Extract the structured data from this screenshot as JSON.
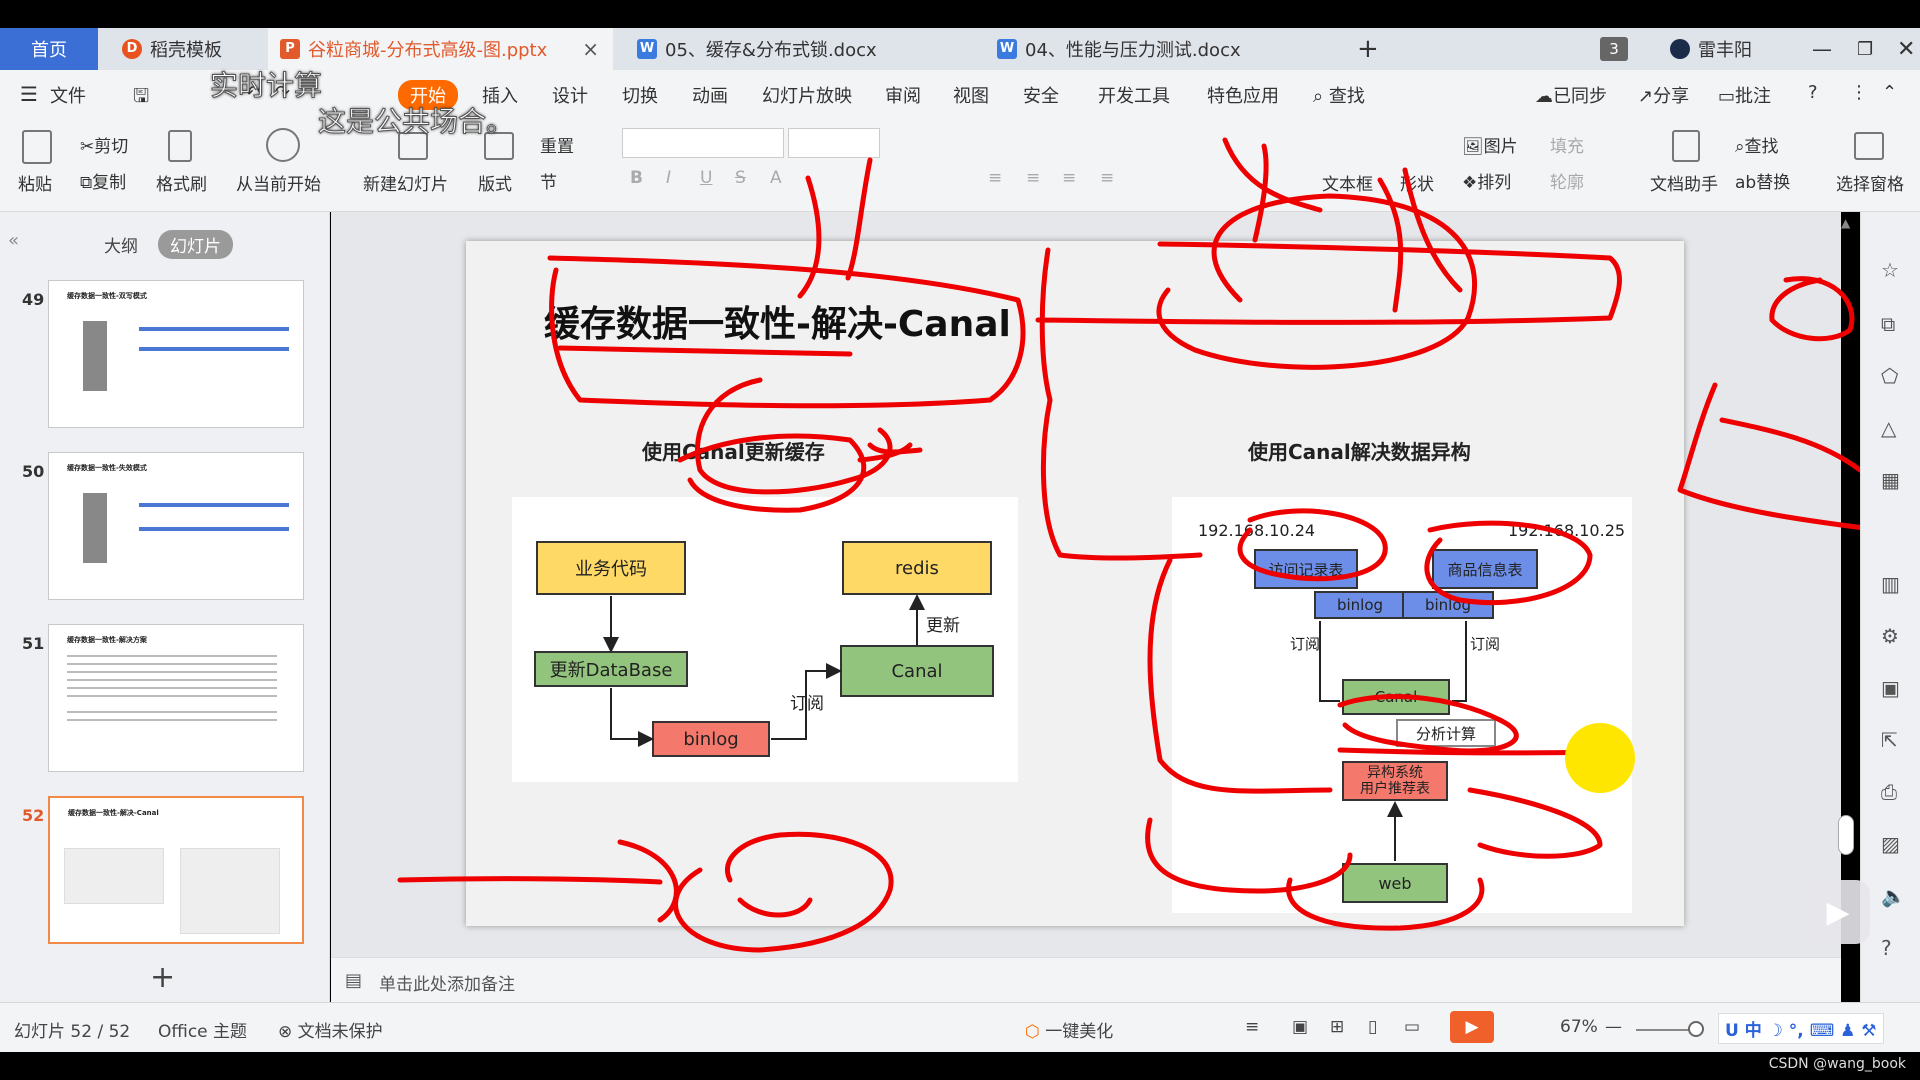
{
  "tabs": {
    "home": "首页",
    "templates": "稻壳模板",
    "active_file": "谷粒商城-分布式高级-图.pptx",
    "doc1": "05、缓存&分布式锁.docx",
    "doc2": "04、性能与压力测试.docx",
    "add": "+",
    "badge": "3",
    "user": "雷丰阳"
  },
  "overlay": {
    "line1": "实时计算",
    "line2": "这是公共场合。"
  },
  "menu": {
    "file": "文件",
    "start": "开始",
    "insert": "插入",
    "design": "设计",
    "transition": "切换",
    "animation": "动画",
    "slideshow": "幻灯片放映",
    "review": "审阅",
    "view": "视图",
    "security": "安全",
    "dev": "开发工具",
    "special": "特色应用",
    "search": "查找",
    "synced": "已同步",
    "share": "分享",
    "comment": "批注"
  },
  "ribbon": {
    "paste": "粘贴",
    "cut": "剪切",
    "copy": "复制",
    "format_painter": "格式刷",
    "from_current": "从当前开始",
    "new_slide": "新建幻灯片",
    "layout": "版式",
    "reset": "重置",
    "section": "节",
    "picture": "图片",
    "fill": "填充",
    "arrange": "排列",
    "outline": "轮廓",
    "textbox": "文本框",
    "shape": "形状",
    "doc_helper": "文档助手",
    "find": "查找",
    "replace": "替换",
    "select_pane": "选择窗格"
  },
  "leftpane": {
    "outline_tab": "大纲",
    "slides_tab": "幻灯片",
    "add": "+",
    "thumbs": [
      {
        "num": "49",
        "title": "缓存数据一致性-双写模式"
      },
      {
        "num": "50",
        "title": "缓存数据一致性-失效模式"
      },
      {
        "num": "51",
        "title": "缓存数据一致性-解决方案"
      },
      {
        "num": "52",
        "title": "缓存数据一致性-解决-Canal"
      }
    ]
  },
  "slide": {
    "title": "缓存数据一致性-解决-Canal",
    "left_diagram": {
      "title": "使用Canal更新缓存",
      "biz_code": "业务代码",
      "update_db": "更新DataBase",
      "binlog": "binlog",
      "subscribe": "订阅",
      "canal": "Canal",
      "update": "更新",
      "redis": "redis"
    },
    "right_diagram": {
      "title": "使用Canal解决数据异构",
      "ip_left": "192.168.10.24",
      "ip_right": "192.168.10.25",
      "access_log": "访问记录表",
      "product_info": "商品信息表",
      "binlog1": "binlog",
      "binlog2": "binlog",
      "subscribe1": "订阅",
      "subscribe2": "订阅",
      "canal": "Canal",
      "analyze": "分析计算",
      "hetero1": "异构系统",
      "hetero2": "用户推荐表",
      "web": "web"
    }
  },
  "notes": {
    "placeholder": "单击此处添加备注"
  },
  "status": {
    "slide_info": "幻灯片 52 / 52",
    "theme": "Office 主题",
    "protect": "文档未保护",
    "beautify": "一键美化",
    "zoom": "67%",
    "ime": "中",
    "watermark": "CSDN @wang_book"
  },
  "colors": {
    "accent": "#ff6a00",
    "red_ink": "#ee0000",
    "yellow_box": "#ffd966",
    "green_box": "#93c47d",
    "red_box": "#f4786b",
    "blue_box": "#6d8ee8"
  }
}
